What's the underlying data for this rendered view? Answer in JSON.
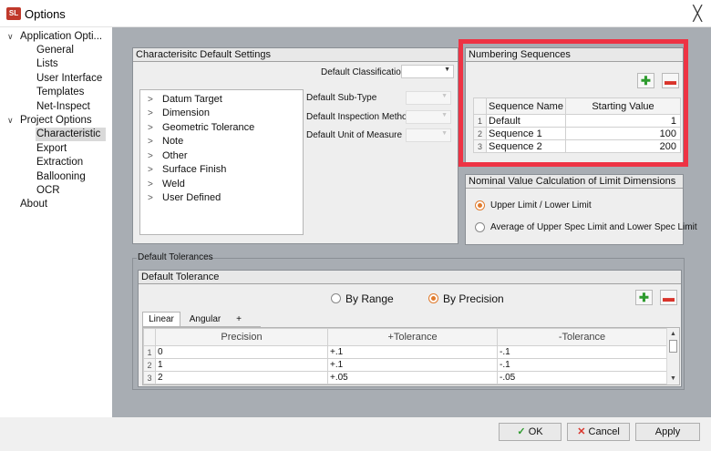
{
  "window": {
    "title": "Options",
    "app_icon": "app-logo-icon",
    "close_glyph": "╳"
  },
  "nav": {
    "items": [
      {
        "label": "Application Opti...",
        "caret": "∨"
      },
      {
        "label": "General"
      },
      {
        "label": "Lists"
      },
      {
        "label": "User Interface"
      },
      {
        "label": "Templates"
      },
      {
        "label": "Net-Inspect"
      },
      {
        "label": "Project Options",
        "caret": "∨"
      },
      {
        "label": "Characteristic",
        "selected": true
      },
      {
        "label": "Export"
      },
      {
        "label": "Extraction"
      },
      {
        "label": "Ballooning"
      },
      {
        "label": "OCR"
      },
      {
        "label": "About"
      }
    ]
  },
  "char_defaults": {
    "title": "Characterisitc Default Settings",
    "default_classification_label": "Default Classification",
    "default_subtype_label": "Default Sub-Type",
    "default_inspection_label": "Default Inspection Method",
    "default_unit_label": "Default Unit of Measure",
    "tree": [
      {
        "label": "Datum Target"
      },
      {
        "label": "Dimension"
      },
      {
        "label": "Geometric Tolerance"
      },
      {
        "label": "Note"
      },
      {
        "label": "Other"
      },
      {
        "label": "Surface Finish"
      },
      {
        "label": "Weld"
      },
      {
        "label": "User Defined"
      }
    ]
  },
  "numbering": {
    "title": "Numbering Sequences",
    "columns": [
      "Sequence Name",
      "Starting Value"
    ],
    "rows": [
      {
        "n": "1",
        "name": "Default",
        "start": "1"
      },
      {
        "n": "2",
        "name": "Sequence 1",
        "start": "100"
      },
      {
        "n": "3",
        "name": "Sequence 2",
        "start": "200"
      }
    ],
    "highlight_color": "#ee3344"
  },
  "nominal": {
    "title": "Nominal Value Calculation of Limit Dimensions",
    "options": [
      {
        "label": "Upper Limit / Lower Limit",
        "selected": true
      },
      {
        "label": "Average of Upper Spec Limit and Lower Spec Limit",
        "selected": false
      }
    ]
  },
  "tolerances": {
    "group_label": "Default Tolerances",
    "header": "Default Tolerance",
    "by_range": "By Range",
    "by_precision": "By Precision",
    "mode_selected": "By Precision",
    "tabs": [
      "Linear",
      "Angular",
      "+"
    ],
    "active_tab": "Linear",
    "columns": [
      "Precision",
      "+Tolerance",
      "-Tolerance"
    ],
    "rows": [
      {
        "n": "1",
        "precision": "0",
        "plus": "+.1",
        "minus": "-.1"
      },
      {
        "n": "2",
        "precision": "1",
        "plus": "+.1",
        "minus": "-.1"
      },
      {
        "n": "3",
        "precision": "2",
        "plus": "+.05",
        "minus": "-.05"
      }
    ]
  },
  "footer": {
    "ok": "OK",
    "cancel": "Cancel",
    "apply": "Apply",
    "ok_glyph": "✓",
    "cancel_glyph": "✕"
  }
}
